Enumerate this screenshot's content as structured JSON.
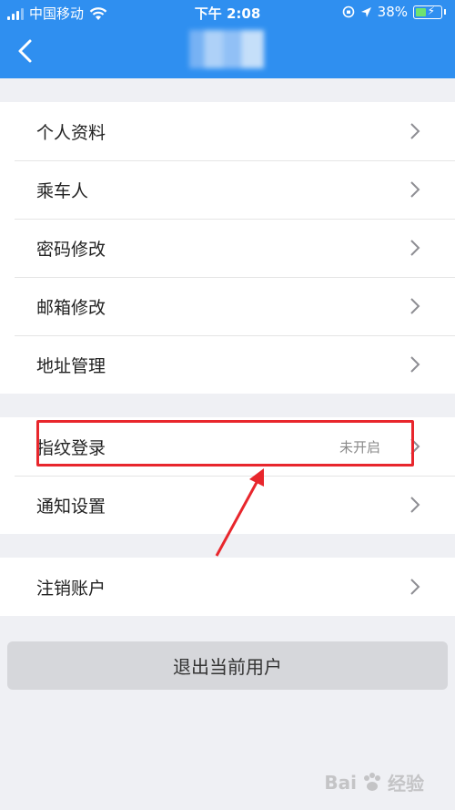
{
  "status_bar": {
    "carrier": "中国移动",
    "time": "下午 2:08",
    "battery": "38%"
  },
  "nav": {
    "back_icon": "chevron-left-icon"
  },
  "groups": [
    {
      "items": [
        "个人资料",
        "乘车人",
        "密码修改",
        "邮箱修改",
        "地址管理"
      ]
    },
    {
      "items": [
        "指纹登录",
        "通知设置"
      ],
      "fingerprint_status": "未开启"
    },
    {
      "items": [
        "注销账户"
      ]
    }
  ],
  "logout_label": "退出当前用户",
  "watermark": {
    "left": "Bai",
    "right": "经验"
  },
  "colors": {
    "header_blue": "#2f8ff0",
    "annotation_red": "#e8262c",
    "page_background": "#eff0f4"
  }
}
